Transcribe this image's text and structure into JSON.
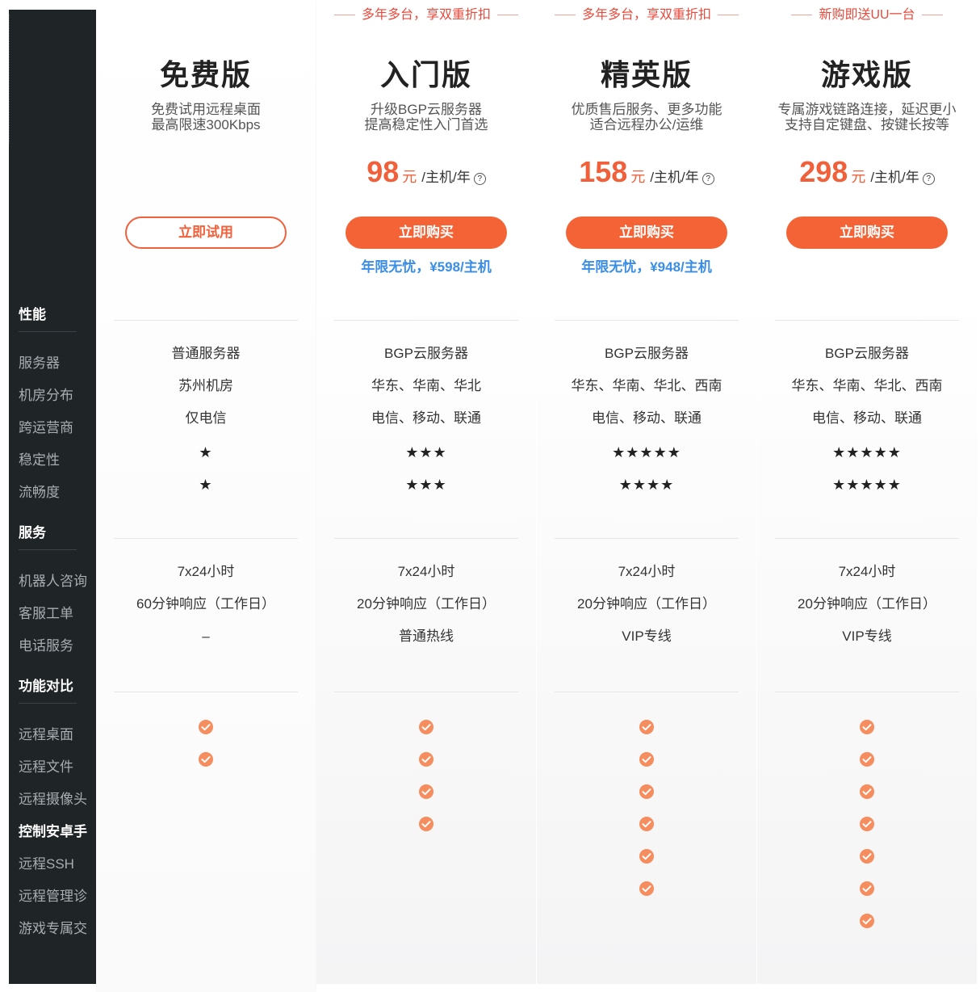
{
  "sidebar": {
    "sections": {
      "performance": "性能",
      "service": "服务",
      "features": "功能对比"
    },
    "performance_items": [
      "服务器",
      "机房分布",
      "跨运营商",
      "稳定性",
      "流畅度"
    ],
    "service_items": [
      "机器人咨询",
      "客服工单",
      "电话服务"
    ],
    "feature_items": [
      "远程桌面",
      "远程文件",
      "远程摄像头",
      "控制安卓手",
      "远程SSH",
      "远程管理诊",
      "游戏专属交"
    ],
    "active_item": "控制安卓手"
  },
  "plans": [
    {
      "promo": "",
      "name": "免费版",
      "desc1": "免费试用远程桌面",
      "desc2": "最高限速300Kbps",
      "price": "",
      "currency": "",
      "unit": "",
      "button": "立即试用",
      "renew": "",
      "server": "普通服务器",
      "region": "苏州机房",
      "carrier": "仅电信",
      "stability": "★",
      "smoothness": "★",
      "bot": "7x24小时",
      "ticket": "60分钟响应（工作日）",
      "phone": "–",
      "features": [
        true,
        true,
        false,
        false,
        false,
        false,
        false
      ]
    },
    {
      "promo": "多年多台，享双重折扣",
      "name": "入门版",
      "desc1": "升级BGP云服务器",
      "desc2": "提高稳定性入门首选",
      "price": "98",
      "currency": "元",
      "unit": "/主机/年",
      "button": "立即购买",
      "renew": "年限无忧，¥598/主机",
      "server": "BGP云服务器",
      "region": "华东、华南、华北",
      "carrier": "电信、移动、联通",
      "stability": "★★★",
      "smoothness": "★★★",
      "bot": "7x24小时",
      "ticket": "20分钟响应（工作日）",
      "phone": "普通热线",
      "features": [
        true,
        true,
        true,
        true,
        false,
        false,
        false
      ]
    },
    {
      "promo": "多年多台，享双重折扣",
      "name": "精英版",
      "desc1": "优质售后服务、更多功能",
      "desc2": "适合远程办公/运维",
      "price": "158",
      "currency": "元",
      "unit": "/主机/年",
      "button": "立即购买",
      "renew": "年限无忧，¥948/主机",
      "server": "BGP云服务器",
      "region": "华东、华南、华北、西南",
      "carrier": "电信、移动、联通",
      "stability": "★★★★★",
      "smoothness": "★★★★",
      "bot": "7x24小时",
      "ticket": "20分钟响应（工作日）",
      "phone": "VIP专线",
      "features": [
        true,
        true,
        true,
        true,
        true,
        true,
        false
      ]
    },
    {
      "promo": "新购即送UU一台",
      "name": "游戏版",
      "desc1": "专属游戏链路连接，延迟更小",
      "desc2": "支持自定键盘、按键长按等",
      "price": "298",
      "currency": "元",
      "unit": "/主机/年",
      "button": "立即购买",
      "renew": "",
      "server": "BGP云服务器",
      "region": "华东、华南、华北、西南",
      "carrier": "电信、移动、联通",
      "stability": "★★★★★",
      "smoothness": "★★★★★",
      "bot": "7x24小时",
      "ticket": "20分钟响应（工作日）",
      "phone": "VIP专线",
      "features": [
        true,
        true,
        true,
        true,
        true,
        true,
        true
      ]
    }
  ],
  "colors": {
    "accent": "#f46336",
    "promo": "#e64a3c",
    "renew": "#3a8ee6",
    "sidebar": "#1f2427",
    "check": "#f68d5e"
  },
  "icons": {
    "check": "orange-check-circle-icon",
    "help": "question-circle-icon"
  }
}
